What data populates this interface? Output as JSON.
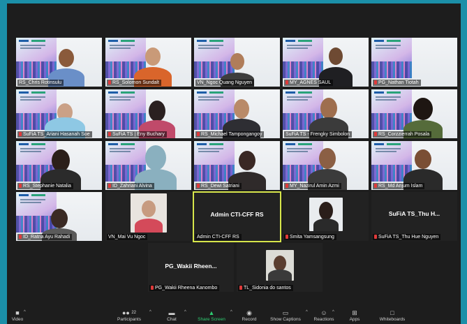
{
  "participants": [
    {
      "name": "RS_Chris Rotinsulu",
      "muted": false
    },
    {
      "name": "RS_Solomon Sundalt",
      "muted": true
    },
    {
      "name": "VN_Ngoc Quang Nguyen",
      "muted": false
    },
    {
      "name": "MY_AGNES SAUL",
      "muted": true
    },
    {
      "name": "PG_Nathan Tiotah",
      "muted": true
    },
    {
      "name": "SuFiA TS_Ariani Hasanah Soe",
      "muted": true
    },
    {
      "name": "SuFiA TS | Eny Buchary",
      "muted": true
    },
    {
      "name": "RS_Michael Tampongangoy",
      "muted": true
    },
    {
      "name": "SuFiA TS - Frengky Simbolon",
      "muted": false
    },
    {
      "name": "RS_Corzzierrah Posala",
      "muted": true
    },
    {
      "name": "RS_Stephanie Natalia",
      "muted": true
    },
    {
      "name": "ID_Zahriani Alvina",
      "muted": true
    },
    {
      "name": "RS_Dewi Satriani",
      "muted": true
    },
    {
      "name": "MY_Nazirul Amin Azmi",
      "muted": true
    },
    {
      "name": "RS_Md Anjum Islam",
      "muted": true
    },
    {
      "name": "ID_Ratna Ayu Rahadi",
      "muted": true
    },
    {
      "name": "VN_Mai Vu Ngoc",
      "muted": false
    },
    {
      "name": "Admin CTI-CFF RS",
      "muted": false,
      "title": "Admin CTI-CFF RS"
    },
    {
      "name": "Smita Yamsangsung",
      "muted": true
    },
    {
      "name": "SuFiA TS_Thu Hue Nguyen",
      "muted": true,
      "title": "SuFiA TS_Thu H..."
    },
    {
      "name": "PG_Wakii Rheena Kanombo",
      "muted": true,
      "title": "PG_Wakii  Rheen..."
    },
    {
      "name": "TL_Sidonia do santos",
      "muted": true
    }
  ],
  "toolbar": {
    "video": "Video",
    "participants": "Participants",
    "participants_count": "22",
    "chat": "Chat",
    "share": "Share Screen",
    "record": "Record",
    "captions": "Show Captions",
    "reactions": "Reactions",
    "apps": "Apps",
    "whiteboards": "Whiteboards"
  },
  "colors": {
    "outer_border": "#1b8fa8",
    "active_speaker": "#d7e64b",
    "share_green": "#2ecc71",
    "muted_red": "#e03a3a"
  }
}
